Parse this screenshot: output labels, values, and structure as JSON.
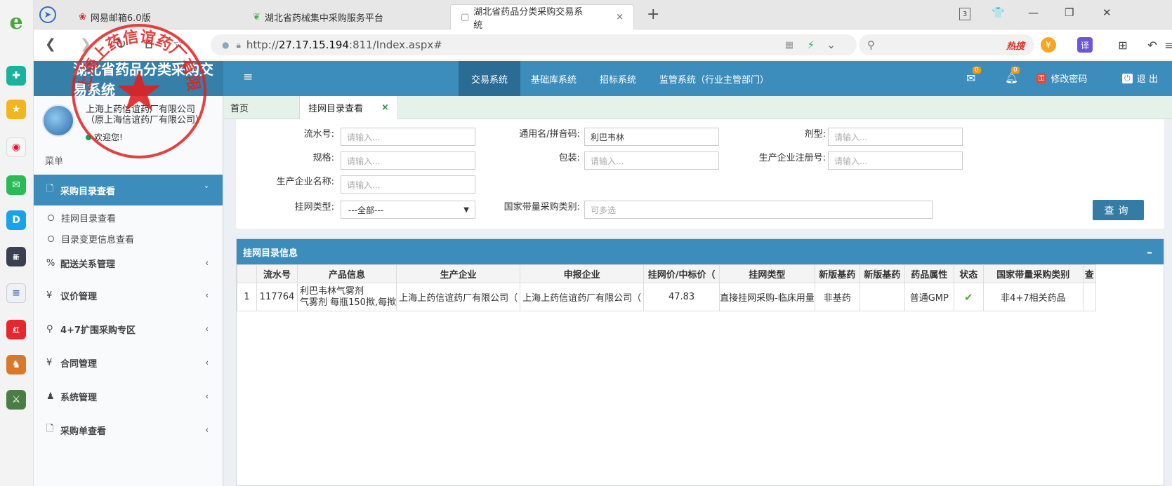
{
  "browser": {
    "tabs": [
      {
        "label": "网易邮箱6.0版",
        "icon": "netease-icon"
      },
      {
        "label": "湖北省药械集中采购服务平台",
        "icon": "leaf-icon"
      },
      {
        "label": "湖北省药品分类采购交易系统",
        "icon": "page-icon",
        "active": true
      }
    ],
    "url_prefix": "http://",
    "url_host": "27.17.15.194",
    "url_suffix": ":811/Index.aspx#",
    "search_hot": "热搜",
    "tab_count": "3"
  },
  "app": {
    "title": "湖北省药品分类采购交易系统",
    "nav": [
      "交易系统",
      "基础库系统",
      "招标系统",
      "监管系统（行业主管部门）"
    ],
    "mail_badge": "0",
    "bell_badge": "0",
    "change_password": "修改密码",
    "logout": "退 出"
  },
  "user": {
    "line1": "上海上药信谊药厂有限公司",
    "line2": "（原上海信谊药厂有限公司）",
    "welcome": "欢迎您!"
  },
  "sidebar": {
    "header": "菜单",
    "items": [
      {
        "label": "采购目录查看",
        "icon": "file-icon",
        "arrow": "˅"
      },
      {
        "label": "配送关系管理",
        "icon": "percent-icon",
        "arrow": "‹"
      },
      {
        "label": "议价管理",
        "icon": "yen-icon",
        "arrow": "‹"
      },
      {
        "label": "4+7扩围采购专区",
        "icon": "pin-icon",
        "arrow": "‹"
      },
      {
        "label": "合同管理",
        "icon": "yen-icon",
        "arrow": "‹"
      },
      {
        "label": "系统管理",
        "icon": "user-icon",
        "arrow": "‹"
      },
      {
        "label": "采购单查看",
        "icon": "file-icon",
        "arrow": "‹"
      }
    ],
    "subitems": [
      "挂网目录查看",
      "目录变更信息查看"
    ]
  },
  "content_tabs": {
    "home": "首页",
    "active": "挂网目录查看",
    "close": "×"
  },
  "search": {
    "serial_label": "流水号:",
    "generic_label": "通用名/拼音码:",
    "form_label": "剂型:",
    "spec_label": "规格:",
    "pack_label": "包装:",
    "reg_label": "生产企业注册号:",
    "maker_label": "生产企业名称:",
    "listing_label": "挂网类型:",
    "national_label": "国家带量采购类别:",
    "placeholder": "请输入...",
    "generic_value": "利巴韦林",
    "listing_value": "---全部---",
    "national_placeholder": "可多选",
    "query_button": "查询"
  },
  "results": {
    "title": "挂网目录信息",
    "collapse": "–",
    "columns": [
      "",
      "流水号",
      "产品信息",
      "生产企业",
      "申报企业",
      "挂网价/中标价（",
      "挂网类型",
      "新版基药",
      "新版基药",
      "药品属性",
      "状态",
      "国家带量采购类别",
      "查"
    ],
    "rows": [
      {
        "index": "1",
        "serial": "117764",
        "product_line1": "利巴韦林气雾剂",
        "product_line2": "气雾剂 每瓶150揿,每揿",
        "maker": "上海上药信谊药厂有限公司（",
        "applicant": "上海上药信谊药厂有限公司（",
        "price": "47.83",
        "listing_type": "直接挂网采购-临床用量",
        "basic1": "非基药",
        "basic2": "",
        "attribute": "普通GMP",
        "national": "非4+7相关药品"
      }
    ]
  },
  "stamp": {
    "text": "上海上药信谊药厂有限公司",
    "color": "#e02020"
  }
}
